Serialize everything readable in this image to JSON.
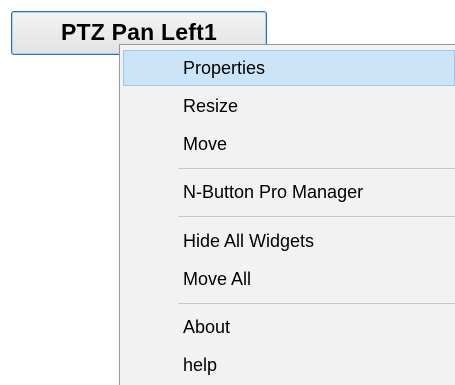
{
  "widget": {
    "label": "PTZ Pan Left1"
  },
  "context_menu": {
    "items": [
      {
        "label": "Properties"
      },
      {
        "label": "Resize"
      },
      {
        "label": "Move"
      },
      {
        "label": "N-Button Pro Manager"
      },
      {
        "label": "Hide All Widgets"
      },
      {
        "label": "Move All"
      },
      {
        "label": "About"
      },
      {
        "label": "help"
      }
    ],
    "highlighted_item": "Properties"
  },
  "colors": {
    "menu_background": "#f2f2f2",
    "highlight_background": "#cce4f7",
    "highlight_border": "#99c9ef",
    "widget_border": "#2f6fb5"
  }
}
